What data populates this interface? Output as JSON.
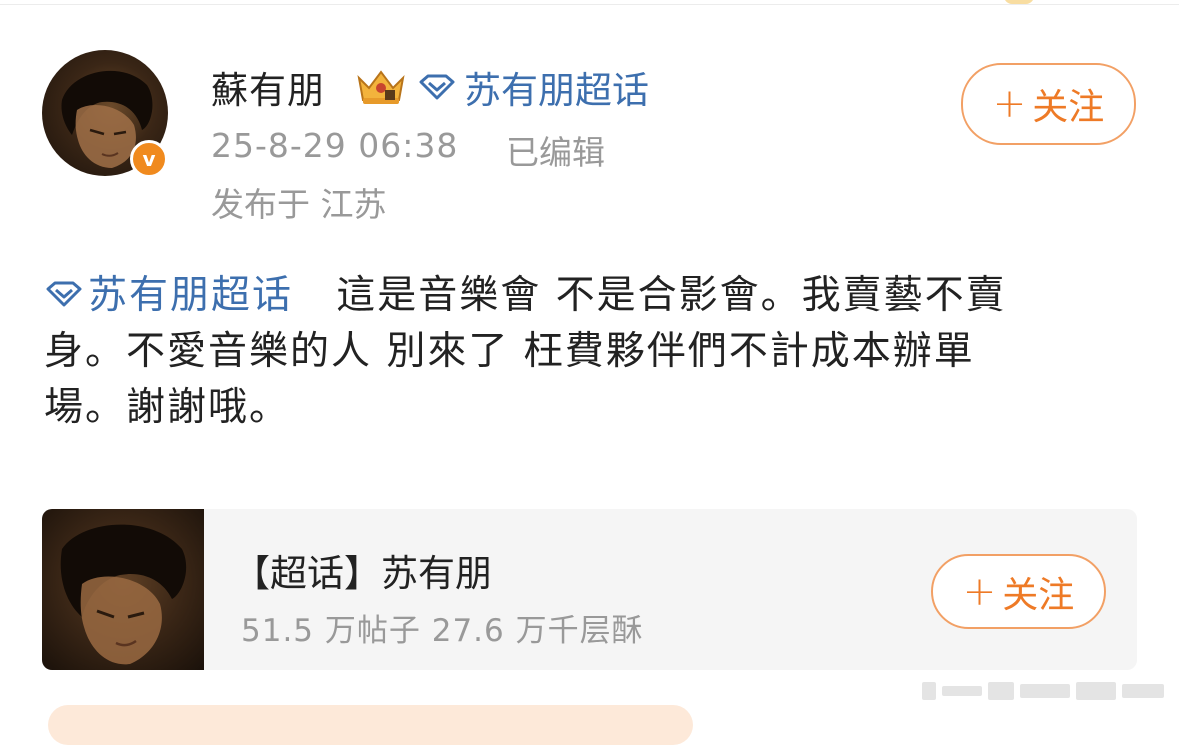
{
  "post": {
    "author": {
      "name": "蘇有朋",
      "verified_icon": "verified-badge-icon",
      "crown_icon": "crown-icon",
      "colors": {
        "verified": "#f08a1e"
      }
    },
    "topic_tag": "苏有朋超话",
    "time": "25-8-29 06:38",
    "edited": "已编辑",
    "location": "发布于 江苏",
    "follow_label": "关注",
    "content": {
      "topic": "苏有朋超话",
      "text_line1": "這是音樂會 不是合影會。我賣藝不賣",
      "text_line2": "身。不愛音樂的人 別來了 枉費夥伴們不計成本辦單",
      "text_line3": "場。謝謝哦。"
    }
  },
  "card": {
    "title": "【超话】苏有朋",
    "stats": "51.5 万帖子 27.6 万千层酥",
    "follow_label": "关注"
  },
  "colors": {
    "link": "#3d6fae",
    "accent": "#ee7a26",
    "muted": "#999999"
  }
}
